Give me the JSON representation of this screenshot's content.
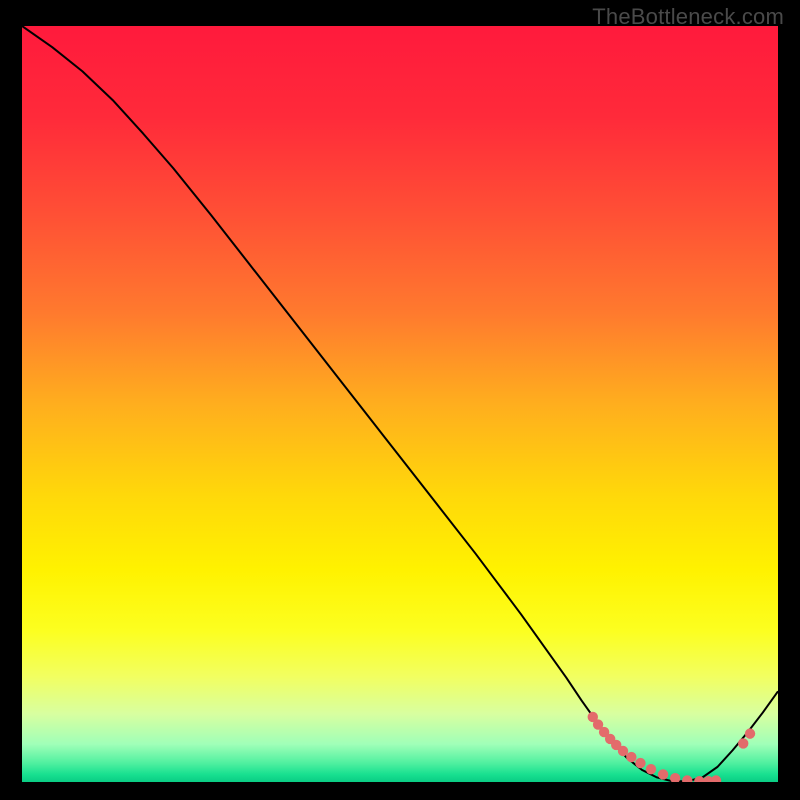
{
  "watermark": "TheBottleneck.com",
  "chart_data": {
    "type": "line",
    "title": "",
    "xlabel": "",
    "ylabel": "",
    "xlim": [
      0,
      100
    ],
    "ylim": [
      0,
      100
    ],
    "grid": false,
    "series": [
      {
        "name": "curve",
        "color": "#000000",
        "x": [
          0,
          4,
          8,
          12,
          16,
          20,
          25,
          30,
          35,
          40,
          45,
          50,
          55,
          60,
          63,
          66,
          69,
          72,
          74,
          76,
          78,
          80,
          82,
          84,
          86,
          88,
          90,
          92,
          94,
          96,
          98,
          100
        ],
        "y": [
          100,
          97.2,
          94.0,
          90.2,
          85.8,
          81.2,
          75.0,
          68.6,
          62.2,
          55.8,
          49.4,
          43.0,
          36.6,
          30.2,
          26.2,
          22.2,
          18.0,
          13.8,
          10.8,
          8.0,
          5.4,
          3.2,
          1.6,
          0.6,
          0.1,
          0.1,
          0.6,
          2.0,
          4.2,
          6.6,
          9.2,
          12.0
        ]
      },
      {
        "name": "markers",
        "color": "#e36b6b",
        "marker": true,
        "x": [
          75.5,
          76.2,
          77.0,
          77.8,
          78.6,
          79.5,
          80.6,
          81.8,
          83.2,
          84.8,
          86.4,
          88.0,
          89.6,
          90.8,
          91.8,
          95.4,
          96.3
        ],
        "y": [
          8.6,
          7.6,
          6.6,
          5.7,
          4.9,
          4.1,
          3.3,
          2.5,
          1.7,
          1.0,
          0.5,
          0.2,
          0.1,
          0.1,
          0.2,
          5.1,
          6.4
        ]
      }
    ],
    "gradient_stops": [
      {
        "offset": 0.0,
        "color": "#ff1a3c"
      },
      {
        "offset": 0.12,
        "color": "#ff2a3a"
      },
      {
        "offset": 0.25,
        "color": "#ff5035"
      },
      {
        "offset": 0.38,
        "color": "#ff7a2e"
      },
      {
        "offset": 0.5,
        "color": "#ffae1e"
      },
      {
        "offset": 0.62,
        "color": "#ffd80a"
      },
      {
        "offset": 0.72,
        "color": "#fff200"
      },
      {
        "offset": 0.8,
        "color": "#fcff20"
      },
      {
        "offset": 0.86,
        "color": "#f2ff60"
      },
      {
        "offset": 0.91,
        "color": "#d8ffa0"
      },
      {
        "offset": 0.95,
        "color": "#a0ffb8"
      },
      {
        "offset": 0.975,
        "color": "#50f0a0"
      },
      {
        "offset": 0.99,
        "color": "#18e090"
      },
      {
        "offset": 1.0,
        "color": "#0acc84"
      }
    ],
    "marker_radius": 5.2
  }
}
